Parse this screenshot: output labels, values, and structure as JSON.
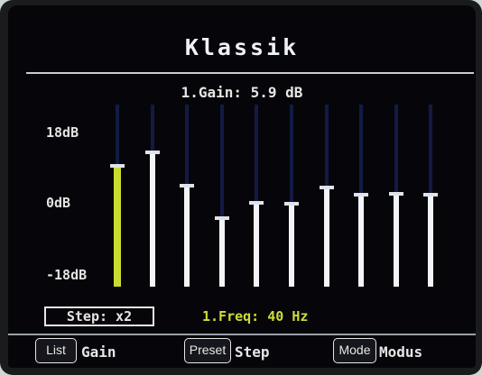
{
  "title": "Klassik",
  "gain_readout": "1.Gain: 5.9 dB",
  "scale": {
    "top": "18dB",
    "mid": "0dB",
    "bottom": "-18dB",
    "min_db": -18,
    "max_db": 18
  },
  "bands": [
    {
      "gain_db": 5.9,
      "selected": true
    },
    {
      "gain_db": 8.5,
      "selected": false
    },
    {
      "gain_db": 2.0,
      "selected": false
    },
    {
      "gain_db": -4.4,
      "selected": false
    },
    {
      "gain_db": -1.4,
      "selected": false
    },
    {
      "gain_db": -1.6,
      "selected": false
    },
    {
      "gain_db": 1.6,
      "selected": false
    },
    {
      "gain_db": 0.2,
      "selected": false
    },
    {
      "gain_db": 0.3,
      "selected": false
    },
    {
      "gain_db": 0.2,
      "selected": false
    }
  ],
  "step_label": "Step: x2",
  "freq_readout": "1.Freq: 40 Hz",
  "softkeys": [
    {
      "button": "List",
      "label": "Gain"
    },
    {
      "button": "Preset",
      "label": "Step"
    },
    {
      "button": "Mode",
      "label": "Modus"
    }
  ],
  "colors": {
    "selected_bar": "#c8dc30",
    "bar": "#f2f4f8",
    "track": "#131a45",
    "freq_text": "#d0dc38"
  }
}
